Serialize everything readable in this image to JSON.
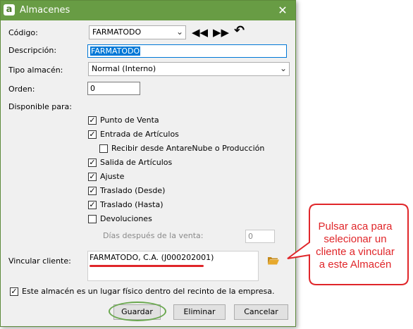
{
  "window": {
    "title": "Almacenes",
    "close_symbol": "✕",
    "app_icon_letter": "a"
  },
  "form": {
    "codigo_label": "Código:",
    "codigo_value": "FARMATODO",
    "descripcion_label": "Descripción:",
    "descripcion_value": "FARMATODO",
    "tipo_label": "Tipo almacén:",
    "tipo_value": "Normal (Interno)",
    "orden_label": "Orden:",
    "orden_value": "0",
    "disponible_label": "Disponible para:",
    "options": [
      {
        "label": "Punto de Venta",
        "checked": true
      },
      {
        "label": "Entrada de Artículos",
        "checked": true
      },
      {
        "label": "Recibir desde AntareNube o Producción",
        "checked": false
      },
      {
        "label": "Salida de Artículos",
        "checked": true
      },
      {
        "label": "Ajuste",
        "checked": true
      },
      {
        "label": "Traslado (Desde)",
        "checked": true
      },
      {
        "label": "Traslado (Hasta)",
        "checked": true
      },
      {
        "label": "Devoluciones",
        "checked": false
      }
    ],
    "dias_label": "Días después de la venta:",
    "dias_value": "0",
    "vincular_label": "Vincular cliente:",
    "cliente_value": "FARMATODO, C.A. (J000202001)",
    "lugar_fisico_label": "Este almacén es un lugar físico dentro del recinto de la empresa.",
    "lugar_fisico_checked": true
  },
  "buttons": {
    "guardar": "Guardar",
    "eliminar": "Eliminar",
    "cancelar": "Cancelar"
  },
  "callout": {
    "text": "Pulsar aca para selecionar un cliente a vincular a este Almacén"
  },
  "colors": {
    "titlebar": "#689c44",
    "highlight": "#0078d7",
    "annotation_red": "#e0262a",
    "annotation_green": "#6aa84f"
  }
}
